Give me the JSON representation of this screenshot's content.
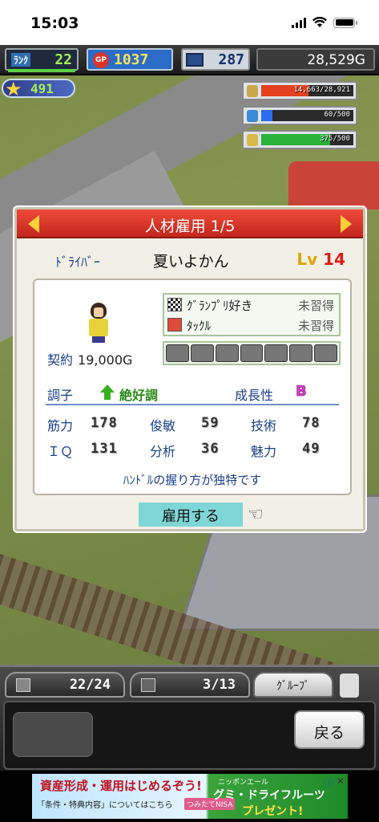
{
  "status_bar": {
    "time": "15:03"
  },
  "hud": {
    "rank_label": "ﾗﾝｸ",
    "rank_value": "22",
    "gp_icon": "GP",
    "gp_value": "1037",
    "pc_value": "287",
    "money": "28,529G",
    "stars": "491",
    "resources": [
      {
        "name": "fuel",
        "icon": "barrel-icon",
        "text": "14,663/28,921",
        "fill": 0.51,
        "color": "#e2401e"
      },
      {
        "name": "water",
        "icon": "water-bottle-icon",
        "text": "60/500",
        "fill": 0.12,
        "color": "#2a6cf0"
      },
      {
        "name": "food",
        "icon": "wheat-icon",
        "text": "375/500",
        "fill": 0.75,
        "color": "#28b238"
      }
    ]
  },
  "dialog": {
    "title": "人材雇用 1/5",
    "job": "ﾄﾞﾗｲﾊﾞｰ",
    "name": "夏いよかん",
    "level_prefix": "Lv",
    "level": "14",
    "contract_label": "契約",
    "contract_value": "19,000G",
    "skills": [
      {
        "name": "ｸﾞﾗﾝﾌﾟﾘ好き",
        "state": "未習得",
        "icon": "checkered-flag-icon"
      },
      {
        "name": "ﾀｯｸﾙ",
        "state": "未習得",
        "icon": "car-crash-icon"
      }
    ],
    "condition_label": "調子",
    "condition_value": "絶好調",
    "growth_label": "成長性",
    "growth_value": "B",
    "stats": [
      {
        "label": "筋力",
        "value": "178"
      },
      {
        "label": "俊敏",
        "value": "59"
      },
      {
        "label": "技術",
        "value": "78"
      },
      {
        "label": "ＩＱ",
        "value": "131"
      },
      {
        "label": "分析",
        "value": "36"
      },
      {
        "label": "魅力",
        "value": "49"
      }
    ],
    "comment": "ﾊﾝﾄﾞﾙの握り方が独特です",
    "hire_label": "雇用する"
  },
  "bottom": {
    "staff_count": "22/24",
    "garage_count": "3/13",
    "group_label": "ｸﾞﾙｰﾌﾟ",
    "back_label": "戻る"
  },
  "ad": {
    "line1": "資産形成・運用はじめるぞう!",
    "line2": "「条件・特典内容」についてはこちら",
    "tag": "つみたてNISA",
    "sponsor": "ニッポンエール",
    "right1": "グミ・ドライフルーツ",
    "right2": "プレゼント!"
  }
}
